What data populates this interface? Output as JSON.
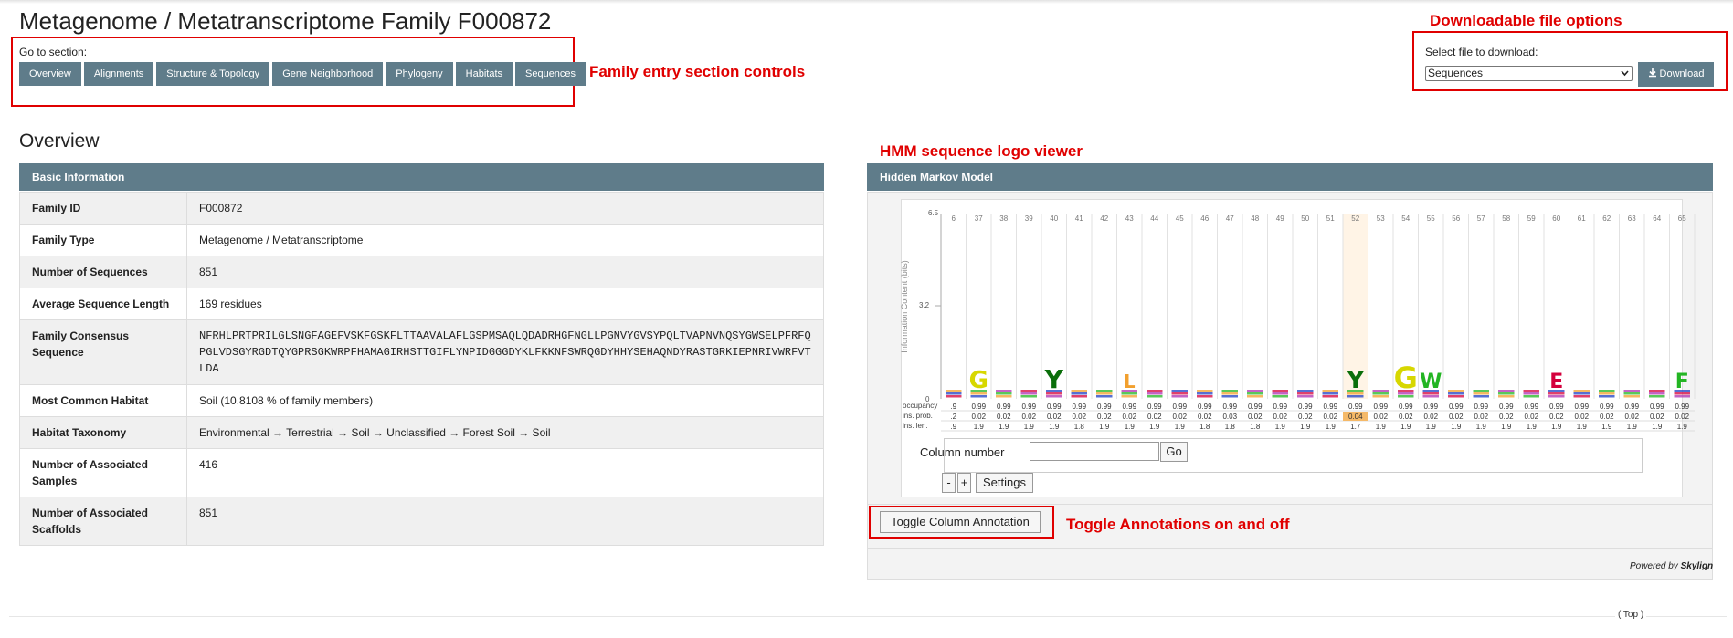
{
  "page": {
    "title": "Metagenome / Metatranscriptome Family F000872"
  },
  "nav": {
    "label": "Go to section:",
    "buttons": [
      "Overview",
      "Alignments",
      "Structure & Topology",
      "Gene Neighborhood",
      "Phylogeny",
      "Habitats",
      "Sequences"
    ]
  },
  "annotations": {
    "family_controls": "Family entry section controls",
    "download_options": "Downloadable file options",
    "hmm_viewer": "HMM sequence logo viewer",
    "toggle": "Toggle Annotations on and off"
  },
  "download": {
    "label": "Select file to download:",
    "selected": "Sequences",
    "button": "Download",
    "icon": "download-icon"
  },
  "overview": {
    "title": "Overview",
    "panel_title": "Basic Information",
    "rows": [
      {
        "key": "Family ID",
        "value": "F000872"
      },
      {
        "key": "Family Type",
        "value": "Metagenome / Metatranscriptome"
      },
      {
        "key": "Number of Sequences",
        "value": "851"
      },
      {
        "key": "Average Sequence Length",
        "value": "169 residues"
      },
      {
        "key": "Family Consensus Sequence",
        "value": "NFRHLPRTPRILGLSNGFAGEFVSKFGSKFLTTAAVALAFLGSPMSAQLQDADRHGFNGLLPGNVYGVSYPQLTVAPNVNQSYGWSELPFRFQPGLVDSGYRGDTQYGPRSGKWRPFHAMAGIRHSTTGIFLYNPIDGGGDYKLFKKNFSWRQGDYHHYSEHAQNDYRASTGRKIEPNRIVWRFVTLDA"
      },
      {
        "key": "Most Common Habitat",
        "value": "Soil (10.8108 % of family members)"
      },
      {
        "key": "Habitat Taxonomy",
        "value": "Environmental → Terrestrial → Soil → Unclassified → Forest Soil → Soil"
      },
      {
        "key": "Number of Associated Samples",
        "value": "416"
      },
      {
        "key": "Number of Associated Scaffolds",
        "value": "851"
      }
    ]
  },
  "hmm": {
    "panel_title": "Hidden Markov Model",
    "y_axis_label": "Information Content (bits)",
    "y_ticks": [
      "6.5",
      "3.2",
      "0"
    ],
    "columns": [
      "6",
      "37",
      "38",
      "39",
      "40",
      "41",
      "42",
      "43",
      "44",
      "45",
      "46",
      "47",
      "48",
      "49",
      "50",
      "51",
      "52",
      "53",
      "54",
      "55",
      "56",
      "57",
      "58",
      "59",
      "60",
      "61",
      "62",
      "63",
      "64",
      "65"
    ],
    "row_labels": [
      "occupancy",
      "ins. prob.",
      "ins. len."
    ],
    "occupancy": [
      ".9",
      "0.99",
      "0.99",
      "0.99",
      "0.99",
      "0.99",
      "0.99",
      "0.99",
      "0.99",
      "0.99",
      "0.99",
      "0.99",
      "0.99",
      "0.99",
      "0.99",
      "0.99",
      "0.99",
      "0.99",
      "0.99",
      "0.99",
      "0.99",
      "0.99",
      "0.99",
      "0.99",
      "0.99",
      "0.99",
      "0.99",
      "0.99",
      "0.99",
      "0.99"
    ],
    "ins_prob": [
      ".2",
      "0.02",
      "0.02",
      "0.02",
      "0.02",
      "0.02",
      "0.02",
      "0.02",
      "0.02",
      "0.02",
      "0.02",
      "0.03",
      "0.02",
      "0.02",
      "0.02",
      "0.02",
      "0.04",
      "0.02",
      "0.02",
      "0.02",
      "0.02",
      "0.02",
      "0.02",
      "0.02",
      "0.02",
      "0.02",
      "0.02",
      "0.02",
      "0.02",
      "0.02"
    ],
    "ins_len": [
      ".9",
      "1.9",
      "1.9",
      "1.9",
      "1.9",
      "1.8",
      "1.9",
      "1.9",
      "1.9",
      "1.9",
      "1.8",
      "1.8",
      "1.8",
      "1.9",
      "1.9",
      "1.9",
      "1.7",
      "1.9",
      "1.9",
      "1.9",
      "1.9",
      "1.9",
      "1.9",
      "1.9",
      "1.9",
      "1.9",
      "1.9",
      "1.9",
      "1.9",
      "1.9"
    ],
    "highlight_index": 16,
    "highlight_color": "#f5b968",
    "letters": [
      {
        "col": 1,
        "letter": "G",
        "color": "#d7d700",
        "height": 20
      },
      {
        "col": 4,
        "letter": "Y",
        "color": "#0a6e0a",
        "height": 22
      },
      {
        "col": 7,
        "letter": "L",
        "color": "#f2a02e",
        "height": 14
      },
      {
        "col": 16,
        "letter": "Y",
        "color": "#0a6e0a",
        "height": 20
      },
      {
        "col": 18,
        "letter": "G",
        "color": "#d7d700",
        "height": 26
      },
      {
        "col": 19,
        "letter": "W",
        "color": "#23b523",
        "height": 16
      },
      {
        "col": 24,
        "letter": "E",
        "color": "#d4003c",
        "height": 16
      },
      {
        "col": 29,
        "letter": "F",
        "color": "#23b523",
        "height": 16
      }
    ],
    "column_label": "Column number",
    "go_label": "Go",
    "minus_label": "-",
    "plus_label": "+",
    "settings_label": "Settings",
    "toggle_label": "Toggle Column Annotation",
    "powered_prefix": "Powered by",
    "powered_brand": "Skylign"
  },
  "footer": {
    "top_link": "( Top )"
  }
}
